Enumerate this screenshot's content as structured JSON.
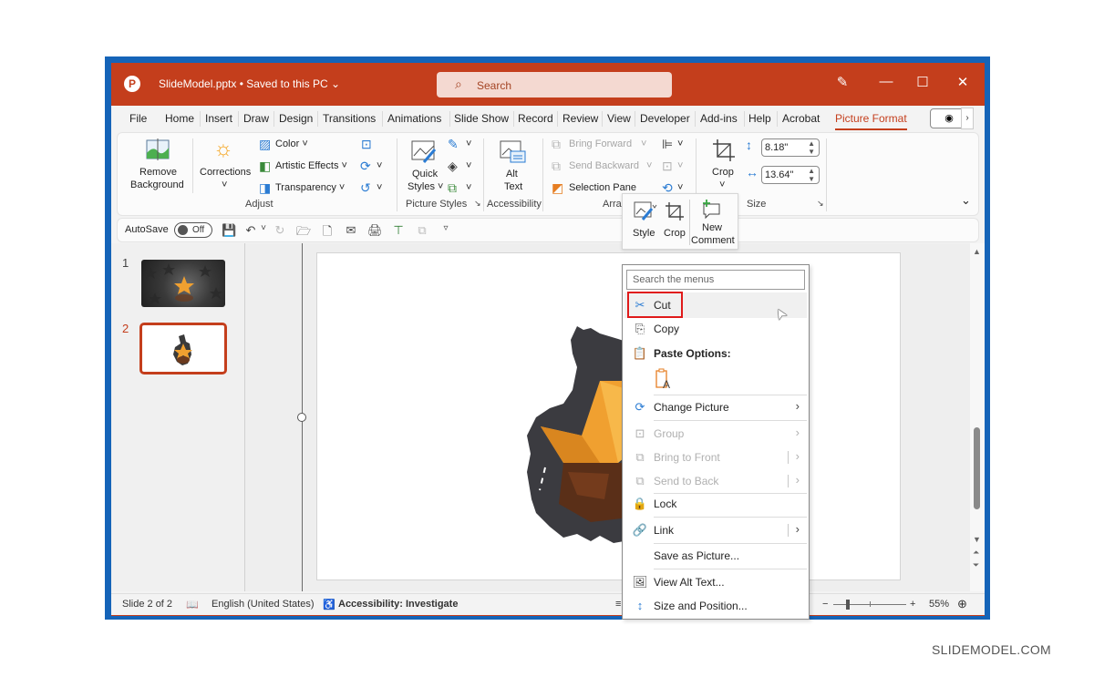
{
  "titlebar": {
    "app_icon": "P",
    "doc_title": "SlideModel.pptx • Saved to this PC ⌄",
    "search_placeholder": "Search",
    "search_icon": "⌕",
    "pen_icon": "✎",
    "minimize_icon": "—",
    "maximize_icon": "☐",
    "close_icon": "✕"
  },
  "tabs": [
    {
      "label": "File"
    },
    {
      "label": "Home"
    },
    {
      "label": "Insert"
    },
    {
      "label": "Draw"
    },
    {
      "label": "Design"
    },
    {
      "label": "Transitions"
    },
    {
      "label": "Animations"
    },
    {
      "label": "Slide Show"
    },
    {
      "label": "Record"
    },
    {
      "label": "Review"
    },
    {
      "label": "View"
    },
    {
      "label": "Developer"
    },
    {
      "label": "Add-ins"
    },
    {
      "label": "Help"
    },
    {
      "label": "Acrobat"
    },
    {
      "label": "Picture Format",
      "active": true
    }
  ],
  "tabs_extra": {
    "record_icon": "◉",
    "more_icon": "›"
  },
  "ribbon": {
    "remove_background": {
      "line1": "Remove",
      "line2": "Background"
    },
    "corrections": "Corrections",
    "color": "Color ˅",
    "artistic_effects": "Artistic Effects ˅",
    "transparency": "Transparency ˅",
    "adjust_group": "Adjust",
    "quick_styles": {
      "line1": "Quick",
      "line2": "Styles ˅"
    },
    "picture_styles_group": "Picture Styles",
    "alt_text": {
      "line1": "Alt",
      "line2": "Text"
    },
    "accessibility_group": "Accessibility",
    "bring_forward": "Bring Forward",
    "send_backward": "Send Backward",
    "selection_pane": "Selection Pane",
    "arrange_group": "Arra",
    "crop": "Crop",
    "height_value": "8.18\"",
    "width_value": "13.64\"",
    "size_group": "Size",
    "collapse_icon": "⌄",
    "dropdown_caret": "˅",
    "launcher_icon": "↘"
  },
  "qat": {
    "autosave_label": "AutoSave",
    "autosave_state": "Off",
    "icons": [
      "💾",
      "↶",
      "˅",
      "↻",
      "🗁",
      "🗋",
      "✉",
      "🖨",
      "⊤",
      "⧉",
      "▿"
    ]
  },
  "thumbnails": [
    {
      "number": "1"
    },
    {
      "number": "2",
      "active": true
    }
  ],
  "mini_toolbar": {
    "style": "Style",
    "crop": "Crop",
    "new_comment_line1": "New",
    "new_comment_line2": "Comment"
  },
  "context_menu": {
    "search_placeholder": "Search the menus",
    "items": [
      {
        "label": "Cut",
        "icon": "✂"
      },
      {
        "label": "Copy",
        "icon": "⎘"
      },
      {
        "label": "Paste Options:",
        "icon": "📋"
      },
      {
        "label": "Change Picture",
        "icon": "⟳",
        "submenu": "›"
      },
      {
        "label": "Group",
        "icon": "⊡",
        "submenu": "›",
        "disabled": true
      },
      {
        "label": "Bring to Front",
        "icon": "⧉",
        "submenu": "›",
        "disabled": true
      },
      {
        "label": "Send to Back",
        "icon": "⧉",
        "submenu": "›",
        "disabled": true
      },
      {
        "label": "Lock",
        "icon": "🔒"
      },
      {
        "label": "Link",
        "icon": "🔗",
        "submenu": "›"
      },
      {
        "label": "Save as Picture...",
        "icon": ""
      },
      {
        "label": "View Alt Text...",
        "icon": "🖼"
      },
      {
        "label": "Size and Position...",
        "icon": "↕"
      }
    ],
    "paste_option_icon": "A"
  },
  "statusbar": {
    "slide_info": "Slide 2 of 2",
    "spell_icon": "📖",
    "language": "English (United States)",
    "accessibility_icon": "♿",
    "accessibility": "Accessibility: Investigate",
    "notes_icon": "≡",
    "zoom_minus": "−",
    "zoom_plus": "+",
    "zoom_level": "55%",
    "fit_icon": "⊕",
    "zoom_fraction": 0.35
  },
  "watermark": "SLIDEMODEL.COM"
}
